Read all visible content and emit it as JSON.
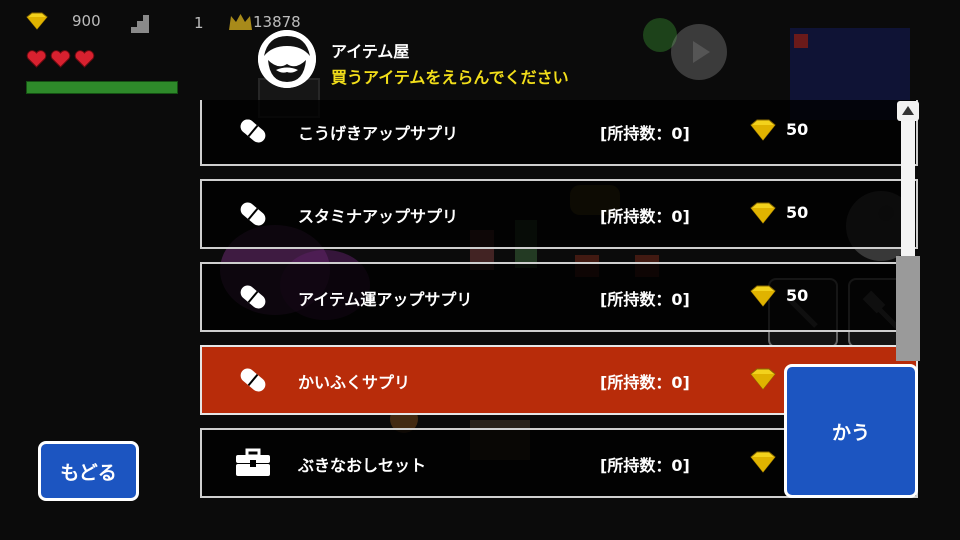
{
  "hud": {
    "gems": "900",
    "floor": "1",
    "score": "13878",
    "hearts": 3,
    "hp_fraction": 1.0
  },
  "shop": {
    "title": "アイテム屋",
    "subtitle": "買うアイテムをえらんでください"
  },
  "items": [
    {
      "name": "こうげきアップサプリ",
      "owned": "[所持数：0]",
      "price": "50",
      "icon": "pill-icon"
    },
    {
      "name": "スタミナアップサプリ",
      "owned": "[所持数：0]",
      "price": "50",
      "icon": "pill-icon"
    },
    {
      "name": "アイテム運アップサプリ",
      "owned": "[所持数：0]",
      "price": "50",
      "icon": "pill-icon"
    },
    {
      "name": "かいふくサプリ",
      "owned": "[所持数：0]",
      "price": "",
      "icon": "pill-icon",
      "selected": true
    },
    {
      "name": "ぶきなおしセット",
      "owned": "[所持数：0]",
      "price": "",
      "icon": "toolbox-icon"
    }
  ],
  "buttons": {
    "buy": "かう",
    "back": "もどる"
  },
  "colors": {
    "selected_row": "#b82c0a",
    "button_blue": "#1c55c1",
    "subtitle_yellow": "#f2de1a",
    "gem_yellow": "#f3d21c"
  }
}
